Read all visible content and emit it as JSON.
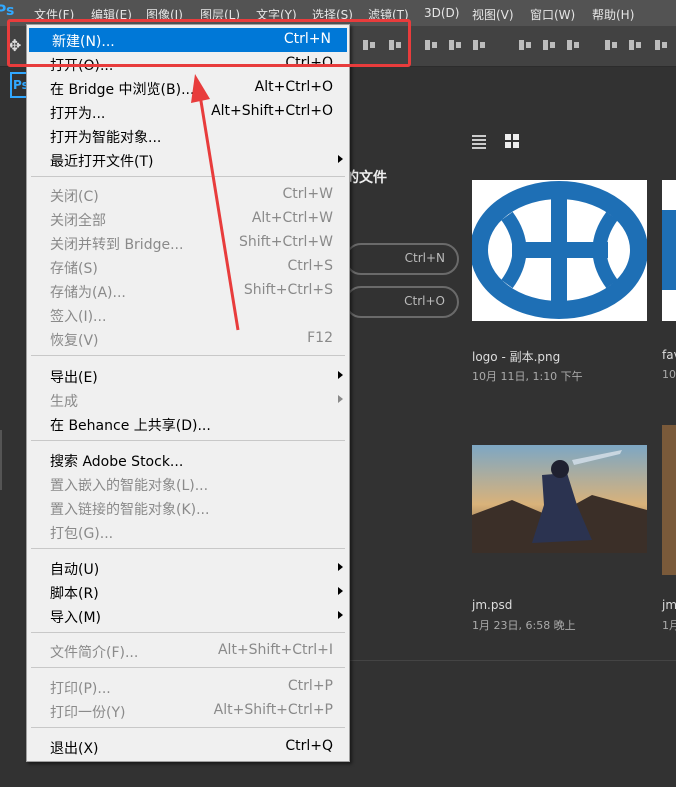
{
  "menubar": {
    "logo": "Ps",
    "items": [
      "文件(F)",
      "编辑(E)",
      "图像(I)",
      "图层(L)",
      "文字(Y)",
      "选择(S)",
      "滤镜(T)",
      "3D(D)",
      "视图(V)",
      "窗口(W)",
      "帮助(H)"
    ]
  },
  "home": {
    "badge": "Ps",
    "recent_heading": "的文件",
    "new_shortcut": "Ctrl+N",
    "open_shortcut": "Ctrl+O",
    "files": [
      {
        "name": "logo - 副本.png",
        "date": "10月 11日, 1:10 下午"
      },
      {
        "name": "fav",
        "date": "10"
      },
      {
        "name": "jm.psd",
        "date": "1月 23日, 6:58 晚上"
      },
      {
        "name": "jm",
        "date": "1月"
      }
    ]
  },
  "file_menu": {
    "items": [
      {
        "label": "新建(N)...",
        "shortcut": "Ctrl+N"
      },
      {
        "label": "打开(O)...",
        "shortcut": "Ctrl+O"
      },
      {
        "label": "在 Bridge 中浏览(B)...",
        "shortcut": "Alt+Ctrl+O"
      },
      {
        "label": "打开为...",
        "shortcut": "Alt+Shift+Ctrl+O"
      },
      {
        "label": "打开为智能对象...",
        "shortcut": ""
      },
      {
        "label": "最近打开文件(T)",
        "shortcut": ""
      },
      {
        "label": "关闭(C)",
        "shortcut": "Ctrl+W"
      },
      {
        "label": "关闭全部",
        "shortcut": "Alt+Ctrl+W"
      },
      {
        "label": "关闭并转到 Bridge...",
        "shortcut": "Shift+Ctrl+W"
      },
      {
        "label": "存储(S)",
        "shortcut": "Ctrl+S"
      },
      {
        "label": "存储为(A)...",
        "shortcut": "Shift+Ctrl+S"
      },
      {
        "label": "签入(I)...",
        "shortcut": ""
      },
      {
        "label": "恢复(V)",
        "shortcut": "F12"
      },
      {
        "label": "导出(E)",
        "shortcut": ""
      },
      {
        "label": "生成",
        "shortcut": ""
      },
      {
        "label": "在 Behance 上共享(D)...",
        "shortcut": ""
      },
      {
        "label": "搜索 Adobe Stock...",
        "shortcut": ""
      },
      {
        "label": "置入嵌入的智能对象(L)...",
        "shortcut": ""
      },
      {
        "label": "置入链接的智能对象(K)...",
        "shortcut": ""
      },
      {
        "label": "打包(G)...",
        "shortcut": ""
      },
      {
        "label": "自动(U)",
        "shortcut": ""
      },
      {
        "label": "脚本(R)",
        "shortcut": ""
      },
      {
        "label": "导入(M)",
        "shortcut": ""
      },
      {
        "label": "文件简介(F)...",
        "shortcut": "Alt+Shift+Ctrl+I"
      },
      {
        "label": "打印(P)...",
        "shortcut": "Ctrl+P"
      },
      {
        "label": "打印一份(Y)",
        "shortcut": "Alt+Shift+Ctrl+P"
      },
      {
        "label": "退出(X)",
        "shortcut": "Ctrl+Q"
      }
    ]
  },
  "colors": {
    "highlight": "#0078d7",
    "annotation": "#e83c3c",
    "logo_blue": "#1e6fb5"
  }
}
